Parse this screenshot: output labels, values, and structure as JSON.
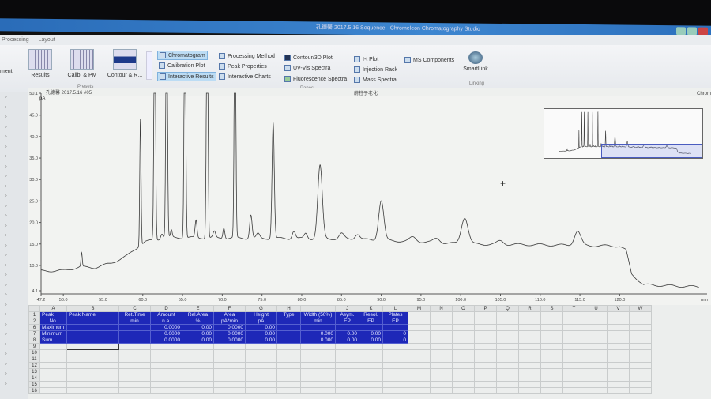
{
  "window": {
    "title": "孔德馨 2017.5.16 Sequence - Chromeleon Chromatography Studio"
  },
  "menu": [
    "Processing",
    "Layout"
  ],
  "ribbon": {
    "presets": {
      "items": [
        "Results",
        "Calib. & PM",
        "Contour & R..."
      ],
      "label": "Presets"
    },
    "panes": {
      "col1": [
        "Chromatogram",
        "Calibration Plot",
        "Interactive Results"
      ],
      "col2": [
        "Processing Method",
        "Peak Properties",
        "Interactive Charts"
      ],
      "col3": [
        "Contour/3D Plot",
        "UV-Vis Spectra",
        "Fluorescence Spectra"
      ],
      "col4": [
        "I-t Plot",
        "Injection Rack",
        "Mass Spectra"
      ],
      "col5": [
        "MS Components"
      ],
      "label": "Panes"
    },
    "linking": {
      "smartlink": "SmartLink",
      "label": "Linking"
    },
    "left_cut": [
      "ment"
    ]
  },
  "chart": {
    "sample": "孔德馨 2017.5.16 #05",
    "center_title": "蔚柱子老化",
    "right_label": "Chrom",
    "yunit": "pA",
    "xunit": "min"
  },
  "chart_data": {
    "type": "line",
    "title": "蔚柱子老化",
    "xlabel": "min",
    "ylabel": "pA",
    "xlim": [
      47.2,
      130
    ],
    "ylim": [
      4.1,
      50.1
    ],
    "xticks": [
      50,
      55,
      60,
      65,
      70,
      75,
      80,
      85,
      90,
      95,
      100,
      105,
      110,
      115,
      120
    ],
    "xtick_labels": [
      "47.2",
      "50.0",
      "55.0",
      "60.0",
      "65.0",
      "70.0",
      "75.0",
      "80.0",
      "85.0",
      "90.0",
      "95.0",
      "100.0",
      "105.0",
      "110.0",
      "115.0",
      "120.0",
      "min"
    ],
    "ytick_labels": [
      "50.1",
      "45.0",
      "40.0",
      "35.0",
      "30.0",
      "25.0",
      "20.0",
      "15.0",
      "10.0",
      "4.1"
    ],
    "yticks": [
      50.1,
      45,
      40,
      35,
      30,
      25,
      20,
      15,
      10,
      4.1
    ],
    "baseline": [
      [
        47.2,
        8.7
      ],
      [
        50,
        8.8
      ],
      [
        52,
        9.6
      ],
      [
        54,
        9.5
      ],
      [
        56,
        10.5
      ],
      [
        58,
        12.2
      ],
      [
        59.5,
        14.5
      ],
      [
        60.3,
        15.5
      ],
      [
        63,
        16.5
      ],
      [
        75,
        16.3
      ],
      [
        85,
        16.2
      ],
      [
        95,
        15.5
      ],
      [
        100,
        15.0
      ],
      [
        110,
        14.8
      ],
      [
        120,
        14.5
      ],
      [
        120.8,
        13.5
      ],
      [
        121.5,
        8
      ],
      [
        123,
        5.5
      ],
      [
        130,
        5.0
      ]
    ],
    "peaks": [
      [
        52.3,
        3.2,
        0.08
      ],
      [
        59.7,
        29.5,
        0.08
      ],
      [
        61.5,
        60,
        0.1
      ],
      [
        62.4,
        1.2,
        0.15
      ],
      [
        63.0,
        60,
        0.1
      ],
      [
        63.6,
        1.6,
        0.1
      ],
      [
        65.3,
        60,
        0.1
      ],
      [
        66.7,
        4,
        0.12
      ],
      [
        68.1,
        60,
        0.1
      ],
      [
        69.0,
        1.4,
        0.15
      ],
      [
        70.2,
        2.5,
        0.12
      ],
      [
        71.6,
        60,
        0.1
      ],
      [
        73.6,
        5.5,
        0.15
      ],
      [
        74.5,
        1,
        0.2
      ],
      [
        76.4,
        27,
        0.14
      ],
      [
        79.0,
        1.8,
        0.2
      ],
      [
        80.5,
        1.2,
        0.2
      ],
      [
        82.3,
        17,
        0.28
      ],
      [
        85.0,
        1.2,
        0.3
      ],
      [
        87.0,
        1.3,
        0.3
      ],
      [
        90.0,
        9.3,
        0.32
      ],
      [
        94.0,
        1,
        0.4
      ],
      [
        97.0,
        1,
        0.4
      ],
      [
        100.5,
        6.2,
        0.42
      ],
      [
        105.0,
        0.8,
        0.4
      ],
      [
        114.7,
        3.3,
        0.4
      ]
    ]
  },
  "table": {
    "col_letters": [
      "A",
      "B",
      "C",
      "D",
      "E",
      "F",
      "G",
      "H",
      "I",
      "J",
      "K",
      "L",
      "M",
      "N",
      "O",
      "P",
      "Q",
      "R",
      "S",
      "T",
      "U",
      "V",
      "W"
    ],
    "row_numbers": [
      "1",
      "2",
      "6",
      "7",
      "8",
      "9",
      "10",
      "11",
      "12",
      "13",
      "14",
      "15",
      "16"
    ],
    "headers1": [
      "Peak",
      "Peak Name",
      "Ret.Time",
      "Amount",
      "Rel.Area",
      "Area",
      "Height",
      "Type",
      "Width (50%)",
      "Asym.",
      "Resol.",
      "Plates"
    ],
    "headers2": [
      "No.",
      "",
      "min",
      "n.a.",
      "%",
      "pA*min",
      "pA",
      "",
      "min",
      "EP",
      "EP",
      "EP"
    ],
    "rows": [
      {
        "label": "Maximum",
        "amount": "0.0000",
        "relarea": "0.00",
        "area": "0.0000",
        "height": "0.00",
        "width": "",
        "asym": "",
        "resol": "",
        "plates": ""
      },
      {
        "label": "Minimum",
        "amount": "0.0000",
        "relarea": "0.00",
        "area": "0.0000",
        "height": "0.00",
        "width": "0.000",
        "asym": "0.00",
        "resol": "0.00",
        "plates": "0"
      },
      {
        "label": "Sum",
        "amount": "0.0000",
        "relarea": "0.00",
        "area": "0.0000",
        "height": "0.00",
        "width": "0.000",
        "asym": "0.00",
        "resol": "0.00",
        "plates": "0"
      }
    ]
  }
}
